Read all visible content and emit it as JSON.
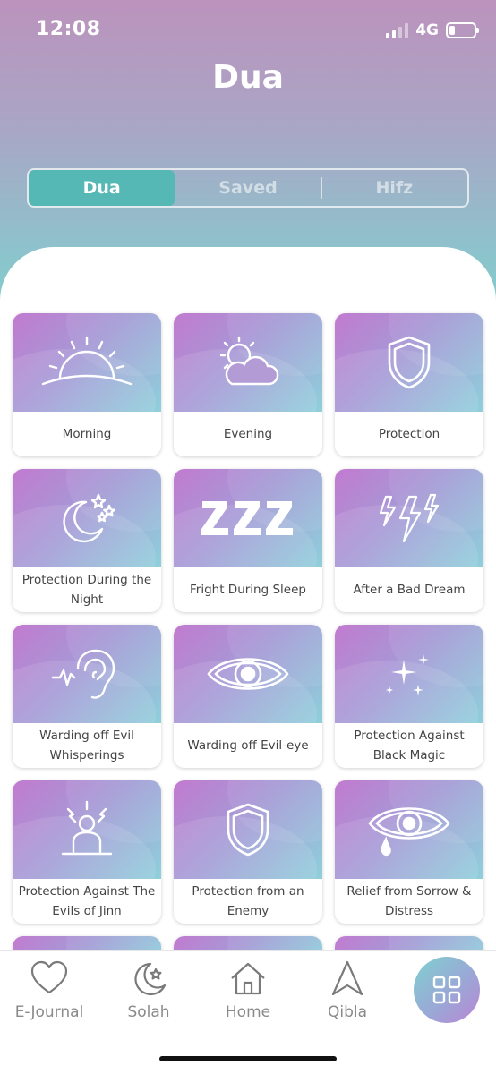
{
  "status_bar": {
    "time": "12:08",
    "network": "4G"
  },
  "header": {
    "title": "Dua"
  },
  "segments": [
    {
      "label": "Dua",
      "active": true
    },
    {
      "label": "Saved",
      "active": false
    },
    {
      "label": "Hifz",
      "active": false
    }
  ],
  "categories": [
    {
      "label": "Morning",
      "icon": "sunrise-icon"
    },
    {
      "label": "Evening",
      "icon": "sun-cloud-icon"
    },
    {
      "label": "Protection",
      "icon": "shield-icon"
    },
    {
      "label": "Protection During the Night",
      "icon": "moon-stars-icon"
    },
    {
      "label": "Fright During Sleep",
      "icon": "zzz-icon"
    },
    {
      "label": "After a Bad Dream",
      "icon": "lightning-icon"
    },
    {
      "label": "Warding off Evil Whisperings",
      "icon": "ear-icon"
    },
    {
      "label": "Warding off Evil-eye",
      "icon": "eye-icon"
    },
    {
      "label": "Protection Against Black Magic",
      "icon": "sparkles-icon"
    },
    {
      "label": "Protection Against The Evils of Jinn",
      "icon": "alarmed-person-icon"
    },
    {
      "label": "Protection from an Enemy",
      "icon": "shield-icon"
    },
    {
      "label": "Relief from Sorrow & Distress",
      "icon": "crying-eye-icon"
    }
  ],
  "tabbar": [
    {
      "label": "E-Journal",
      "icon": "heart-icon"
    },
    {
      "label": "Solah",
      "icon": "crescent-star-icon"
    },
    {
      "label": "Home",
      "icon": "home-icon"
    },
    {
      "label": "Qibla",
      "icon": "compass-arrow-icon"
    },
    {
      "label": "",
      "icon": "grid-menu-icon"
    }
  ],
  "colors": {
    "header_gradient_top": "#bb93bd",
    "header_gradient_bottom": "#7fd0ce",
    "active_segment": "#55b8b4",
    "card_gradient_start": "#c27ad0",
    "card_gradient_end": "#8fd0dc"
  }
}
